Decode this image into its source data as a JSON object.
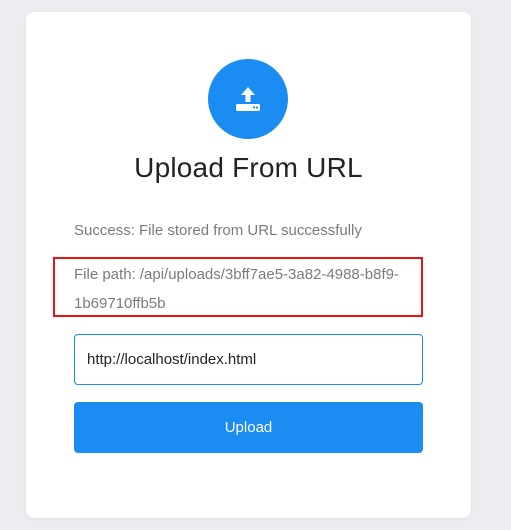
{
  "card": {
    "title": "Upload From URL",
    "success_message": "Success: File stored from URL successfully",
    "file_path_message": "File path: /api/uploads/3bff7ae5-3a82-4988-b8f9-1b69710ffb5b",
    "url_input_value": "http://localhost/index.html",
    "upload_button_label": "Upload",
    "icon": "upload-tray-icon"
  },
  "colors": {
    "accent": "#1b8cf2",
    "highlight": "#e81414",
    "page_background": "#ecedf0",
    "muted_text": "#7a7b80"
  }
}
